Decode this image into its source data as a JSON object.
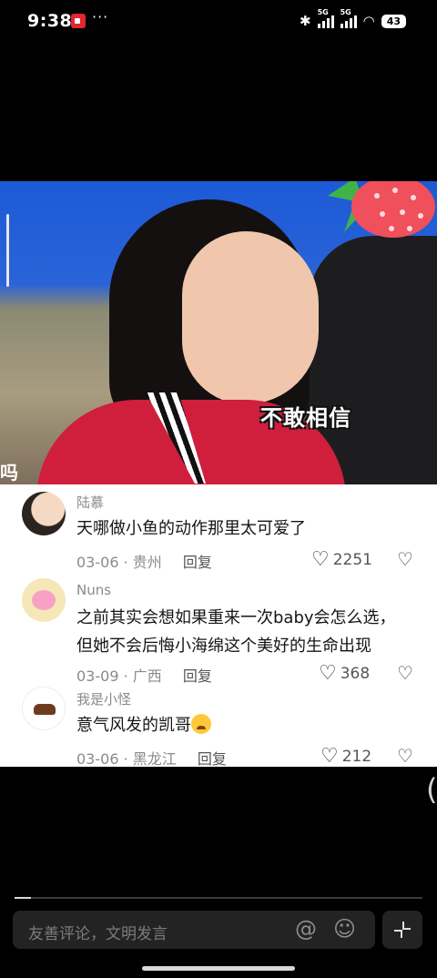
{
  "status_bar": {
    "time": "9:38",
    "more": "···",
    "network1": "5G",
    "network2": "5G",
    "battery": "43"
  },
  "video": {
    "sticker_text": "不敢相信",
    "corner_text": "吗"
  },
  "comments": [
    {
      "user": "陆慕",
      "text": [
        "天哪做小鱼的动作那里太可爱了"
      ],
      "date": "03-06",
      "location": "贵州",
      "reply": "回复",
      "likes": "2251"
    },
    {
      "user": "Nuns",
      "text": [
        "之前其实会想如果重来一次baby会怎么选，",
        "但她不会后悔小海绵这个美好的生命出现"
      ],
      "date": "03-09",
      "location": "广西",
      "reply": "回复",
      "likes": "368"
    },
    {
      "user": "我是小怪",
      "text": [
        "意气风发的凯哥"
      ],
      "date": "03-06",
      "location": "黑龙江",
      "reply": "回复",
      "likes": "212"
    }
  ],
  "progress": 0.04,
  "input": {
    "placeholder": "友善评论，文明发言"
  },
  "icons": {
    "at": "at-icon",
    "emoji": "smile-icon",
    "collapse": "collapse-icon",
    "like": "heart-icon",
    "dislike": "dislike-icon"
  }
}
